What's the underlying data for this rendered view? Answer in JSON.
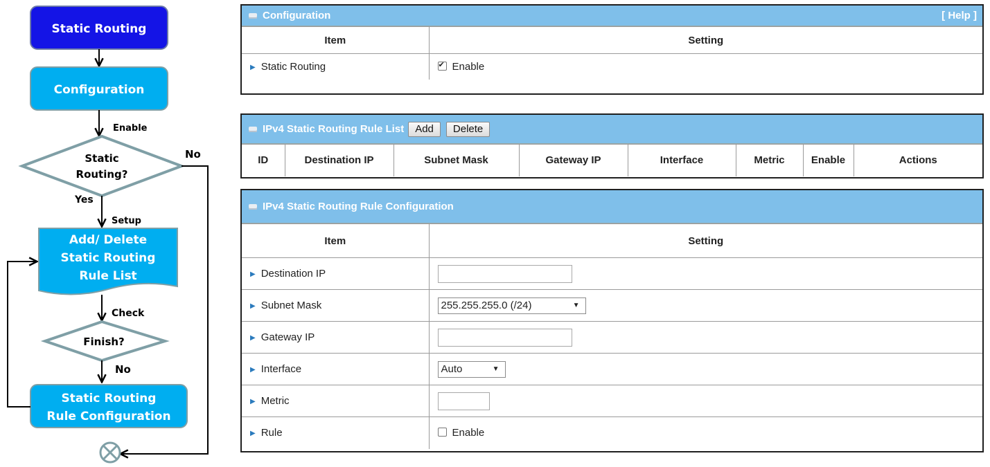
{
  "flowchart": {
    "static_routing": "Static Routing",
    "configuration": "Configuration",
    "enable": "Enable",
    "decision_line1": "Static",
    "decision_line2": "Routing?",
    "no_top": "No",
    "yes": "Yes",
    "setup": "Setup",
    "add_delete_1": "Add/ Delete",
    "add_delete_2": "Static Routing",
    "add_delete_3": "Rule List",
    "check": "Check",
    "finish": "Finish?",
    "no_bottom": "No",
    "rule_config_1": "Static Routing",
    "rule_config_2": "Rule Configuration",
    "colors": {
      "dark_blue": "#1414e6",
      "light_blue": "#00aef0",
      "diamond_border": "#7f9fa6"
    },
    "end_icon": "circle-x-icon"
  },
  "config_panel": {
    "title": "Configuration",
    "help": "[ Help ]",
    "col_item": "Item",
    "col_setting": "Setting",
    "row_label": "Static Routing",
    "row_value": "Enable",
    "enabled": true
  },
  "rule_list_panel": {
    "title": "IPv4 Static Routing Rule List",
    "add_label": "Add",
    "delete_label": "Delete",
    "columns": [
      "ID",
      "Destination IP",
      "Subnet Mask",
      "Gateway IP",
      "Interface",
      "Metric",
      "Enable",
      "Actions"
    ]
  },
  "rule_config_panel": {
    "title": "IPv4 Static Routing Rule Configuration",
    "col_item": "Item",
    "col_setting": "Setting",
    "rows": {
      "dest_ip": {
        "label": "Destination IP",
        "value": ""
      },
      "subnet": {
        "label": "Subnet Mask",
        "value": "255.255.255.0 (/24)"
      },
      "gateway": {
        "label": "Gateway IP",
        "value": ""
      },
      "interface": {
        "label": "Interface",
        "value": "Auto"
      },
      "metric": {
        "label": "Metric",
        "value": ""
      },
      "rule": {
        "label": "Rule",
        "value": "Enable",
        "enabled": false
      }
    }
  },
  "colors": {
    "header_bg": "#7fbfea",
    "border": "#1f1f1f"
  }
}
